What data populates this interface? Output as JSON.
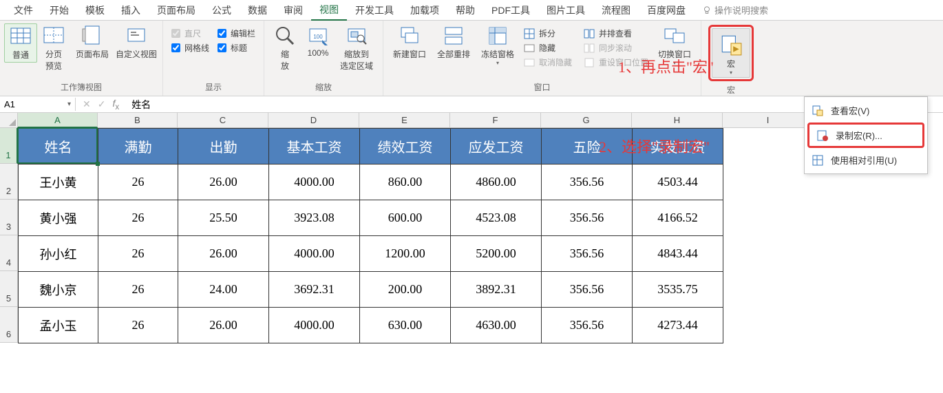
{
  "tabs": [
    "文件",
    "开始",
    "模板",
    "插入",
    "页面布局",
    "公式",
    "数据",
    "审阅",
    "视图",
    "开发工具",
    "加载项",
    "帮助",
    "PDF工具",
    "图片工具",
    "流程图",
    "百度网盘"
  ],
  "active_tab_index": 8,
  "search_hint": "操作说明搜索",
  "groups": {
    "workbook_views": {
      "label": "工作簿视图",
      "normal": "普通",
      "page_break": "分页\n预览",
      "page_layout": "页面布局",
      "custom_views": "自定义视图"
    },
    "show": {
      "label": "显示",
      "ruler": "直尺",
      "gridlines": "网格线",
      "formula_bar": "编辑栏",
      "headings": "标题"
    },
    "zoom": {
      "label": "缩放",
      "zoom": "缩\n放",
      "hundred": "100%",
      "to_selection": "缩放到\n选定区域"
    },
    "window": {
      "label": "窗口",
      "new_window": "新建窗口",
      "arrange_all": "全部重排",
      "freeze": "冻结窗格",
      "split": "拆分",
      "hide": "隐藏",
      "unhide": "取消隐藏",
      "side_by_side": "并排查看",
      "sync_scroll": "同步滚动",
      "reset_pos": "重设窗口位置",
      "switch": "切换窗口"
    },
    "macros": {
      "label": "宏",
      "macro": "宏",
      "view_macros": "查看宏(V)",
      "record_macro": "录制宏(R)...",
      "use_relative": "使用相对引用(U)"
    }
  },
  "annotations": {
    "a1": "1、再点击\"宏\"",
    "a2": "2、选择\"录制宏\""
  },
  "name_box": "A1",
  "formula_value": "姓名",
  "columns": [
    "A",
    "B",
    "C",
    "D",
    "E",
    "F",
    "G",
    "H",
    "I"
  ],
  "rows": [
    "1",
    "2",
    "3",
    "4",
    "5",
    "6"
  ],
  "table": {
    "headers": [
      "姓名",
      "满勤",
      "出勤",
      "基本工资",
      "绩效工资",
      "应发工资",
      "五险",
      "实发工资"
    ],
    "data": [
      [
        "王小黄",
        "26",
        "26.00",
        "4000.00",
        "860.00",
        "4860.00",
        "356.56",
        "4503.44"
      ],
      [
        "黄小强",
        "26",
        "25.50",
        "3923.08",
        "600.00",
        "4523.08",
        "356.56",
        "4166.52"
      ],
      [
        "孙小红",
        "26",
        "26.00",
        "4000.00",
        "1200.00",
        "5200.00",
        "356.56",
        "4843.44"
      ],
      [
        "魏小京",
        "26",
        "24.00",
        "3692.31",
        "200.00",
        "3892.31",
        "356.56",
        "3535.75"
      ],
      [
        "孟小玉",
        "26",
        "26.00",
        "4000.00",
        "630.00",
        "4630.00",
        "356.56",
        "4273.44"
      ]
    ]
  }
}
